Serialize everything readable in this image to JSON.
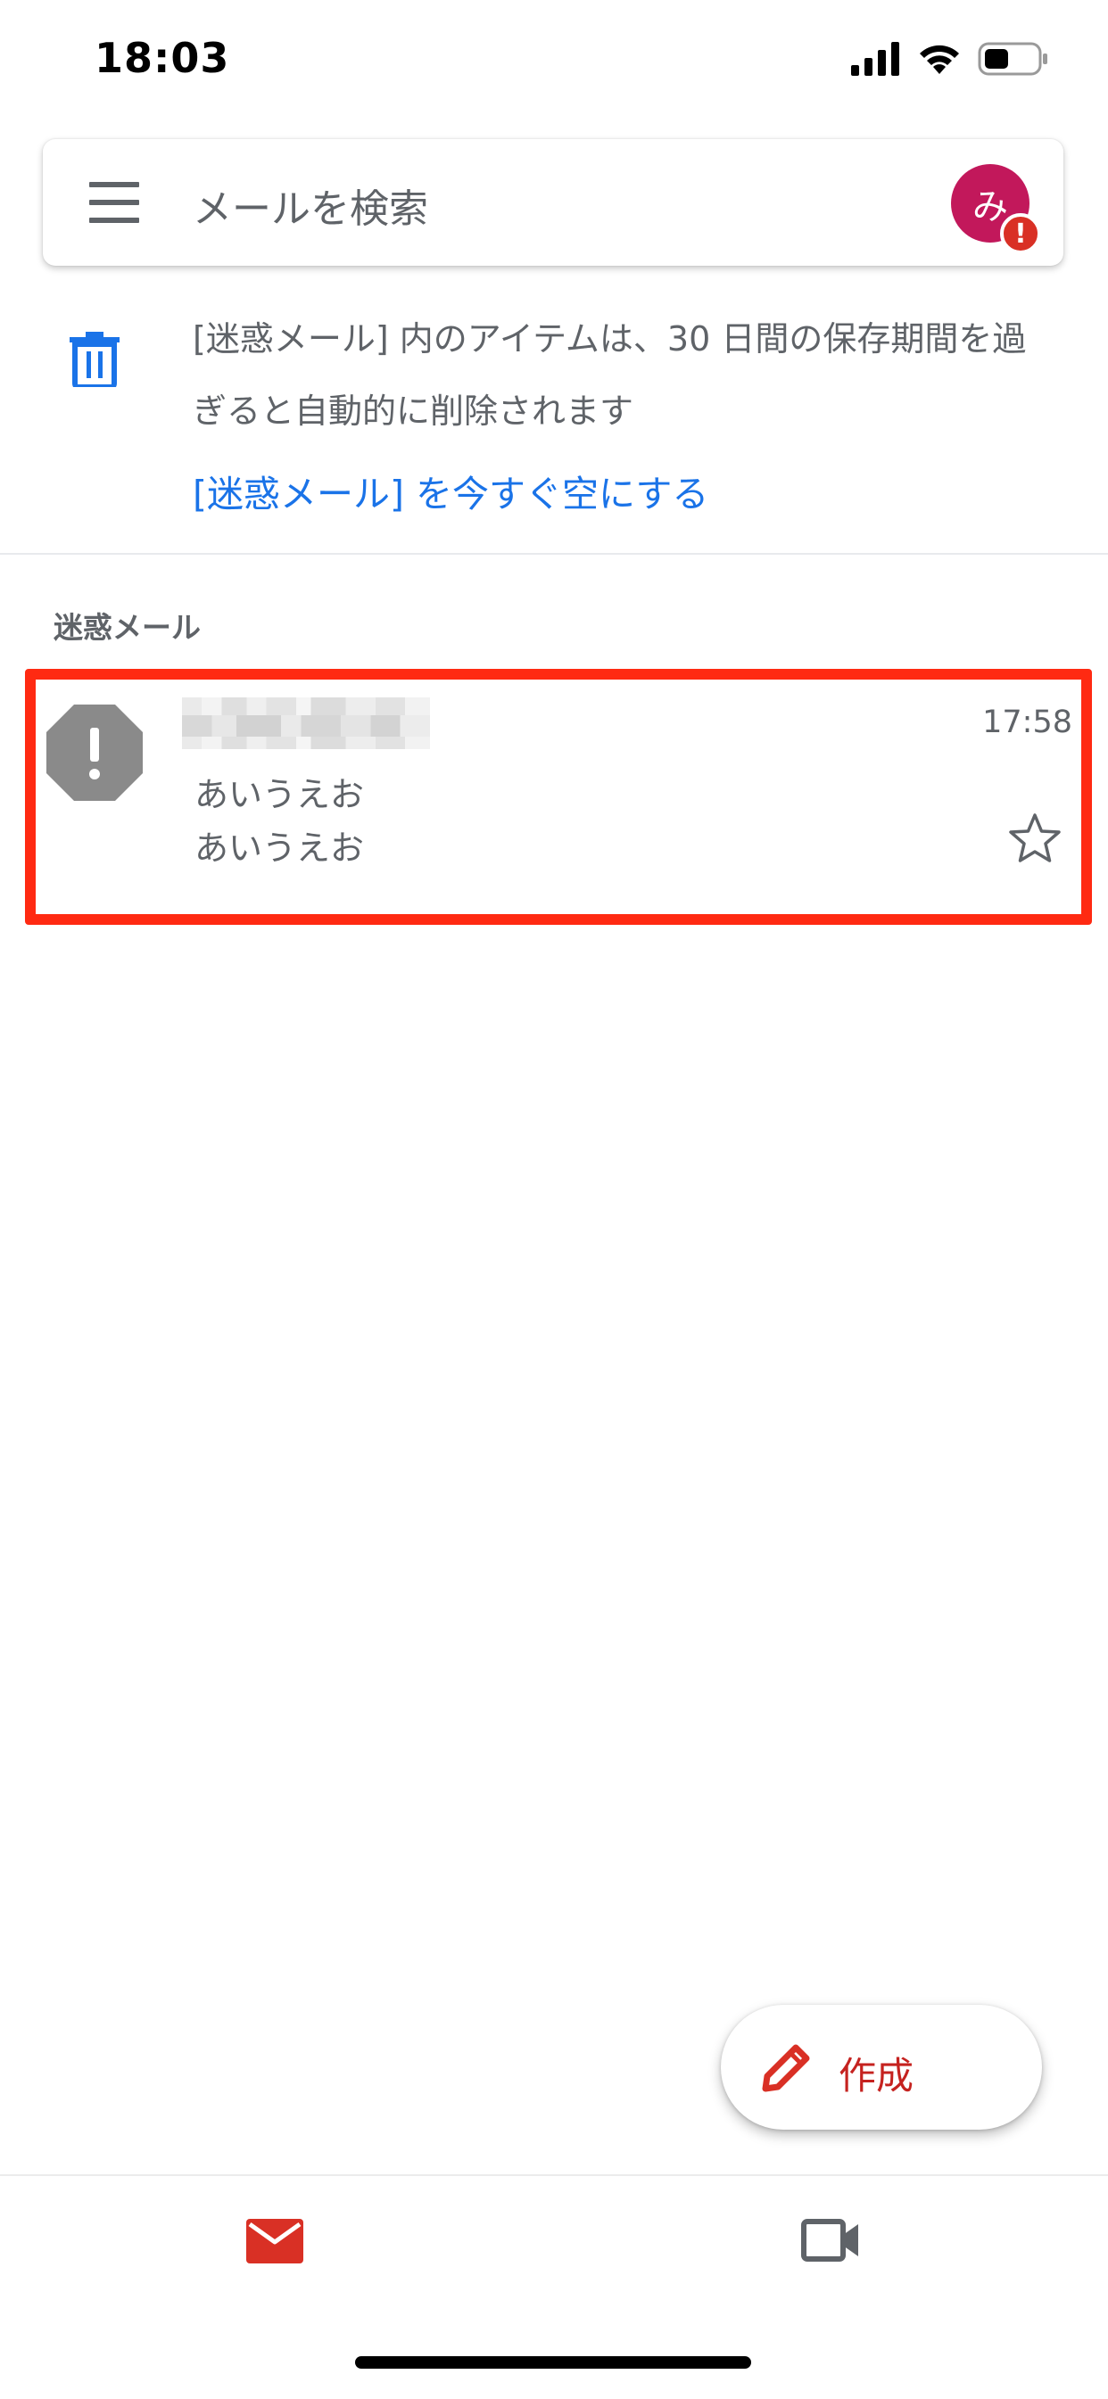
{
  "status_bar": {
    "time": "18:03"
  },
  "search": {
    "placeholder": "メールを検索",
    "avatar_initial": "み",
    "avatar_badge": "!"
  },
  "notice": {
    "text": "[迷惑メール] 内のアイテムは、30 日間の保存期間を過ぎると自動的に削除されます",
    "action": "[迷惑メール] を今すぐ空にする"
  },
  "section": {
    "label": "迷惑メール"
  },
  "mail": {
    "time": "17:58",
    "subject": "あいうえお",
    "snippet": "あいうえお"
  },
  "fab": {
    "label": "作成"
  },
  "colors": {
    "accent_red": "#d93025",
    "link_blue": "#1a73e8",
    "avatar_magenta": "#c2185b",
    "highlight_red": "#ff2a12"
  },
  "icons": [
    "signal-icon",
    "wifi-icon",
    "battery-icon",
    "menu-icon",
    "trash-icon",
    "warning-octagon-icon",
    "star-icon",
    "pencil-icon",
    "mail-icon",
    "video-camera-icon"
  ]
}
